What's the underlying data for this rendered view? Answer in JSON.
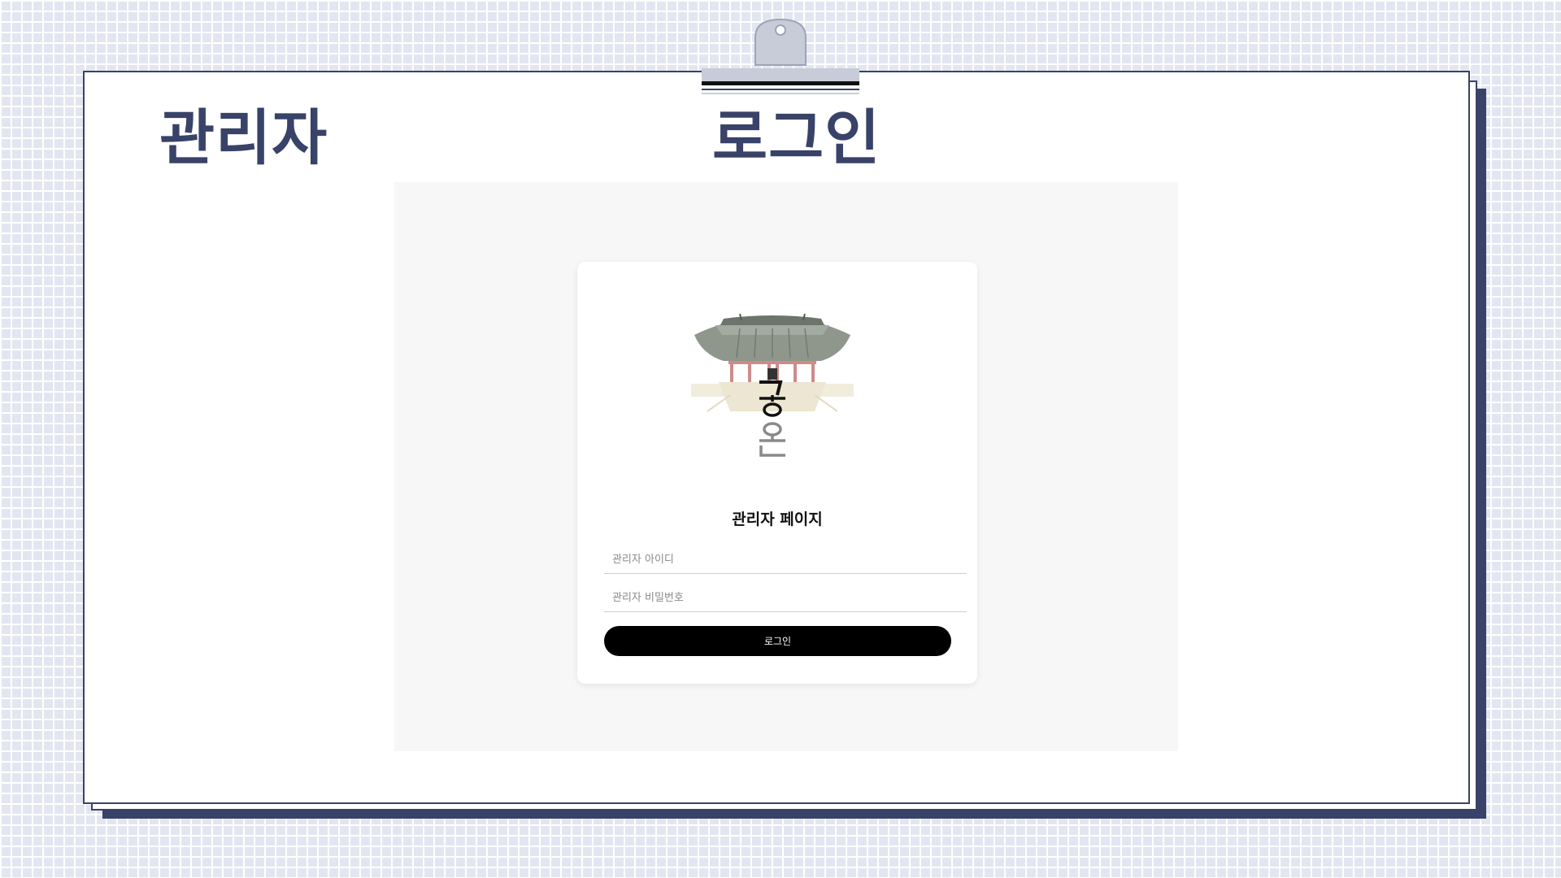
{
  "slide": {
    "title_left": "관리자",
    "title_right": "로그인"
  },
  "login_card": {
    "title": "관리자 페이지",
    "id_placeholder": "관리자 아이디",
    "password_placeholder": "관리자 비밀번호",
    "submit_label": "로그인"
  },
  "logo": {
    "icon": "palace-icon",
    "text": "궁온"
  },
  "colors": {
    "navy": "#394268",
    "background": "#e3e6f0",
    "button": "#000000"
  }
}
